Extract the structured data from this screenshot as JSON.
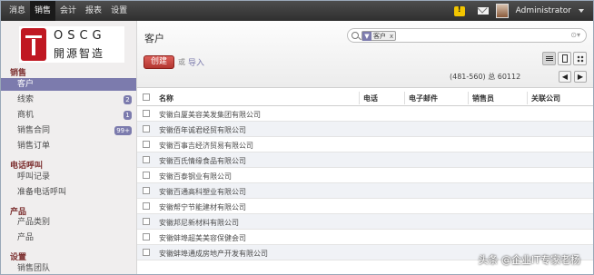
{
  "topbar": {
    "menu": [
      "消息",
      "销售",
      "会计",
      "报表",
      "设置"
    ],
    "user_name": "Administrator"
  },
  "logo": {
    "en": "OSCG",
    "cn": "開源智造"
  },
  "sidebar": {
    "sections": [
      {
        "label": "销售",
        "items": [
          {
            "label": "客户"
          },
          {
            "label": "线索",
            "badge": "2"
          },
          {
            "label": "商机",
            "badge": "1"
          },
          {
            "label": "销售合同",
            "badge": "99+"
          },
          {
            "label": "销售订单"
          }
        ]
      },
      {
        "label": "电话呼叫",
        "items": [
          {
            "label": "呼叫记录"
          },
          {
            "label": "准备电话呼叫"
          }
        ]
      },
      {
        "label": "产品",
        "items": [
          {
            "label": "产品类别"
          },
          {
            "label": "产品"
          }
        ]
      },
      {
        "label": "设置",
        "items": [
          {
            "label": "销售团队"
          }
        ]
      }
    ]
  },
  "main": {
    "title": "客户",
    "search": {
      "facet_label": "客户",
      "facet_close": "x"
    },
    "create_label": "创建",
    "or_label": "或",
    "import_label": "导入",
    "pager": "(481-560) 总 60112",
    "columns": [
      "名称",
      "电话",
      "电子邮件",
      "销售员",
      "关联公司"
    ],
    "rows": [
      "安徽白厦美容美发集团有限公司",
      "安徽佰年诚君经贸有限公司",
      "安徽百事吉经济贸易有限公司",
      "安徽百氏情缘食品有限公司",
      "安徽百泰钢业有限公司",
      "安徽百通高科塑业有限公司",
      "安徽帮宁节能建材有限公司",
      "安徽邦尼新材料有限公司",
      "安徽蚌埠超美美容保健会司",
      "安徽蚌埠通成房地产开发有限公司"
    ]
  },
  "watermark": "头条 @企业IT专家老杨"
}
